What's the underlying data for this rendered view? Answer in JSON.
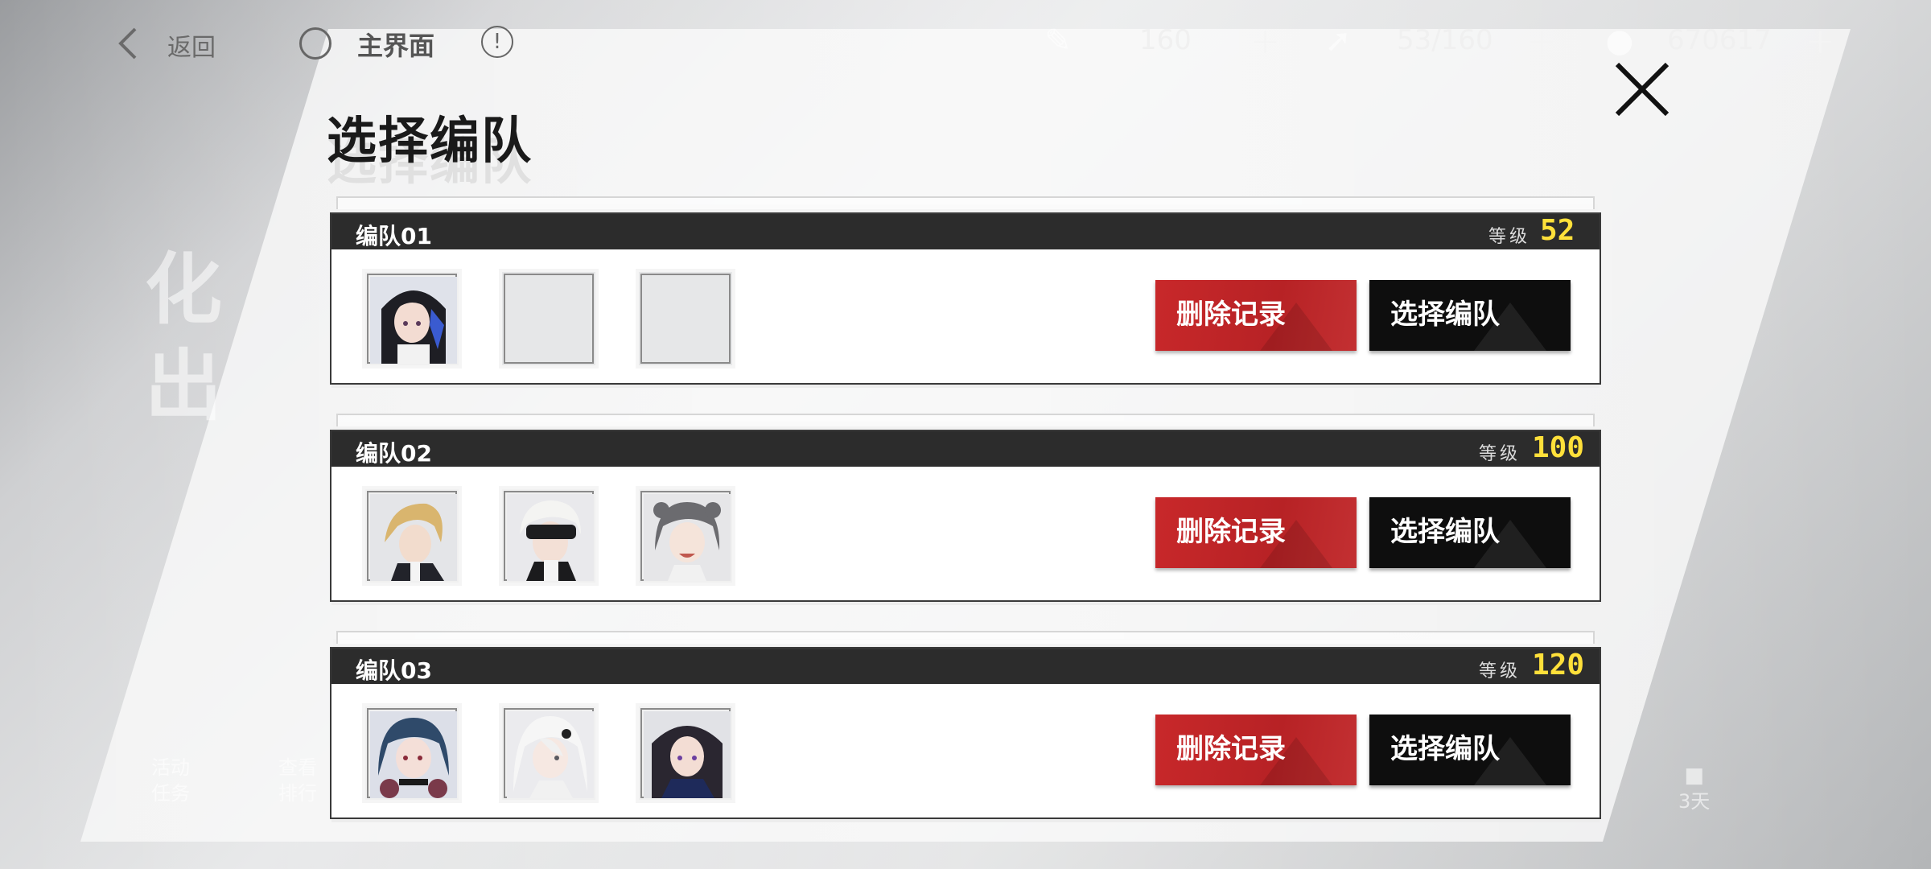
{
  "topbar": {
    "back_label": "返回",
    "home_label": "主界面",
    "info_glyph": "!",
    "resources": [
      {
        "icon": "stamina-icon",
        "value": "160"
      },
      {
        "icon": "energy-icon",
        "value": "53/160"
      },
      {
        "icon": "coin-icon",
        "value": "670617"
      }
    ],
    "plus_glyph": "+"
  },
  "dialog": {
    "title": "选择编队",
    "level_label": "等级",
    "delete_label": "删除记录",
    "select_label": "选择编队",
    "teams": [
      {
        "name": "编队01",
        "level": "52",
        "slots": [
          "portrait-black-hair-blue-ribbon",
          "empty",
          "empty"
        ]
      },
      {
        "name": "编队02",
        "level": "100",
        "slots": [
          "portrait-blonde",
          "portrait-white-hair-blindfold",
          "portrait-grey-twin-tails"
        ]
      },
      {
        "name": "编队03",
        "level": "120",
        "slots": [
          "portrait-dark-blue-hair",
          "portrait-white-hair",
          "portrait-dark-hair-purple-eyes"
        ]
      }
    ]
  },
  "background": {
    "ghost_text_1": "化",
    "ghost_text_2": "出",
    "hint_activity_1": "活动",
    "hint_activity_2": "任务",
    "hint_rank_1": "查看",
    "hint_rank_2": "排行",
    "hint_lock": "3天"
  },
  "colors": {
    "accent_red": "#c8282a",
    "header_dark": "#2c2c2c",
    "level_yellow": "#ffe03a"
  }
}
